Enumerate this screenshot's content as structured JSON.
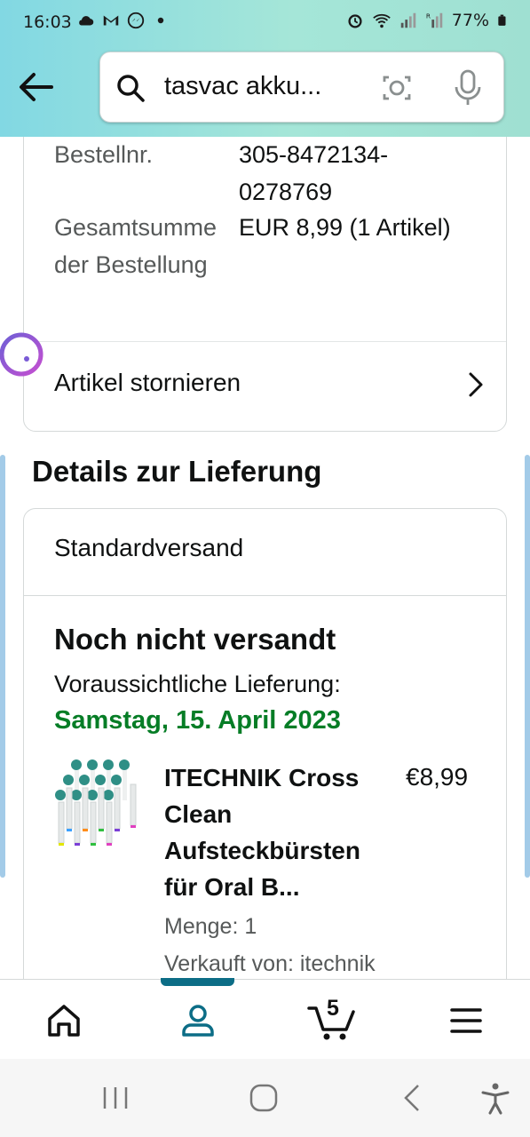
{
  "status_bar": {
    "time": "16:03",
    "battery": "77%"
  },
  "search": {
    "query": "tasvac akku..."
  },
  "order": {
    "fields": [
      {
        "label": "Bestellnr.",
        "value": "305-8472134-0278769"
      },
      {
        "label": "Gesamtsumme der Bestellung",
        "value": "EUR 8,99 (1 Artikel)"
      }
    ],
    "cancel_label": "Artikel stornieren"
  },
  "delivery": {
    "section_title": "Details zur Lieferung",
    "shipping_method": "Standardversand",
    "status": "Noch nicht versandt",
    "expected_label": "Voraussichtliche Lieferung:",
    "expected_date": "Samstag, 15. April 2023",
    "date_color": "#067d26",
    "item": {
      "title": "ITECHNIK Cross Clean Aufsteckbürsten für Oral B...",
      "price": "€8,99",
      "quantity": "Menge: 1",
      "seller": "Verkauft von: itechnik"
    }
  },
  "bottom_nav": {
    "items": [
      "home-icon",
      "account-icon",
      "cart-icon",
      "menu-icon"
    ],
    "cart_count": "5",
    "active": "account",
    "accent": "#0c6d86"
  },
  "system_nav": {
    "items": [
      "recents-icon",
      "home-circle-icon",
      "back-chevron-icon",
      "accessibility-icon"
    ]
  }
}
